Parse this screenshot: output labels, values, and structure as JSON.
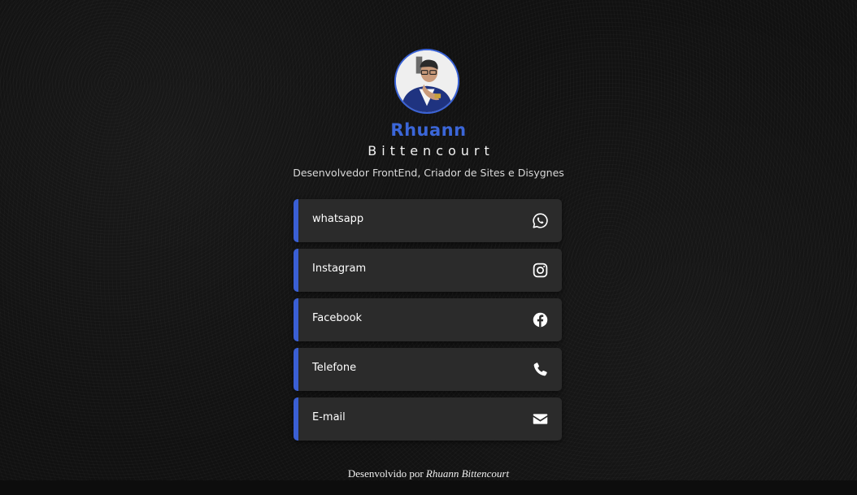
{
  "profile": {
    "first_name": "Rhuann",
    "last_name": "Bittencourt",
    "tagline": "Desenvolvedor FrontEnd, Criador de Sites e Disygnes"
  },
  "links": [
    {
      "label": "whatsapp",
      "icon": "whatsapp-icon"
    },
    {
      "label": "Instagram",
      "icon": "instagram-icon"
    },
    {
      "label": "Facebook",
      "icon": "facebook-icon"
    },
    {
      "label": "Telefone",
      "icon": "phone-icon"
    },
    {
      "label": "E-mail",
      "icon": "envelope-icon"
    }
  ],
  "footer": {
    "prefix": "Desenvolvido por",
    "author": "Rhuann Bittencourt"
  },
  "colors": {
    "accent": "#3a5fd4",
    "card": "#2b2b2b",
    "background": "#111111"
  }
}
